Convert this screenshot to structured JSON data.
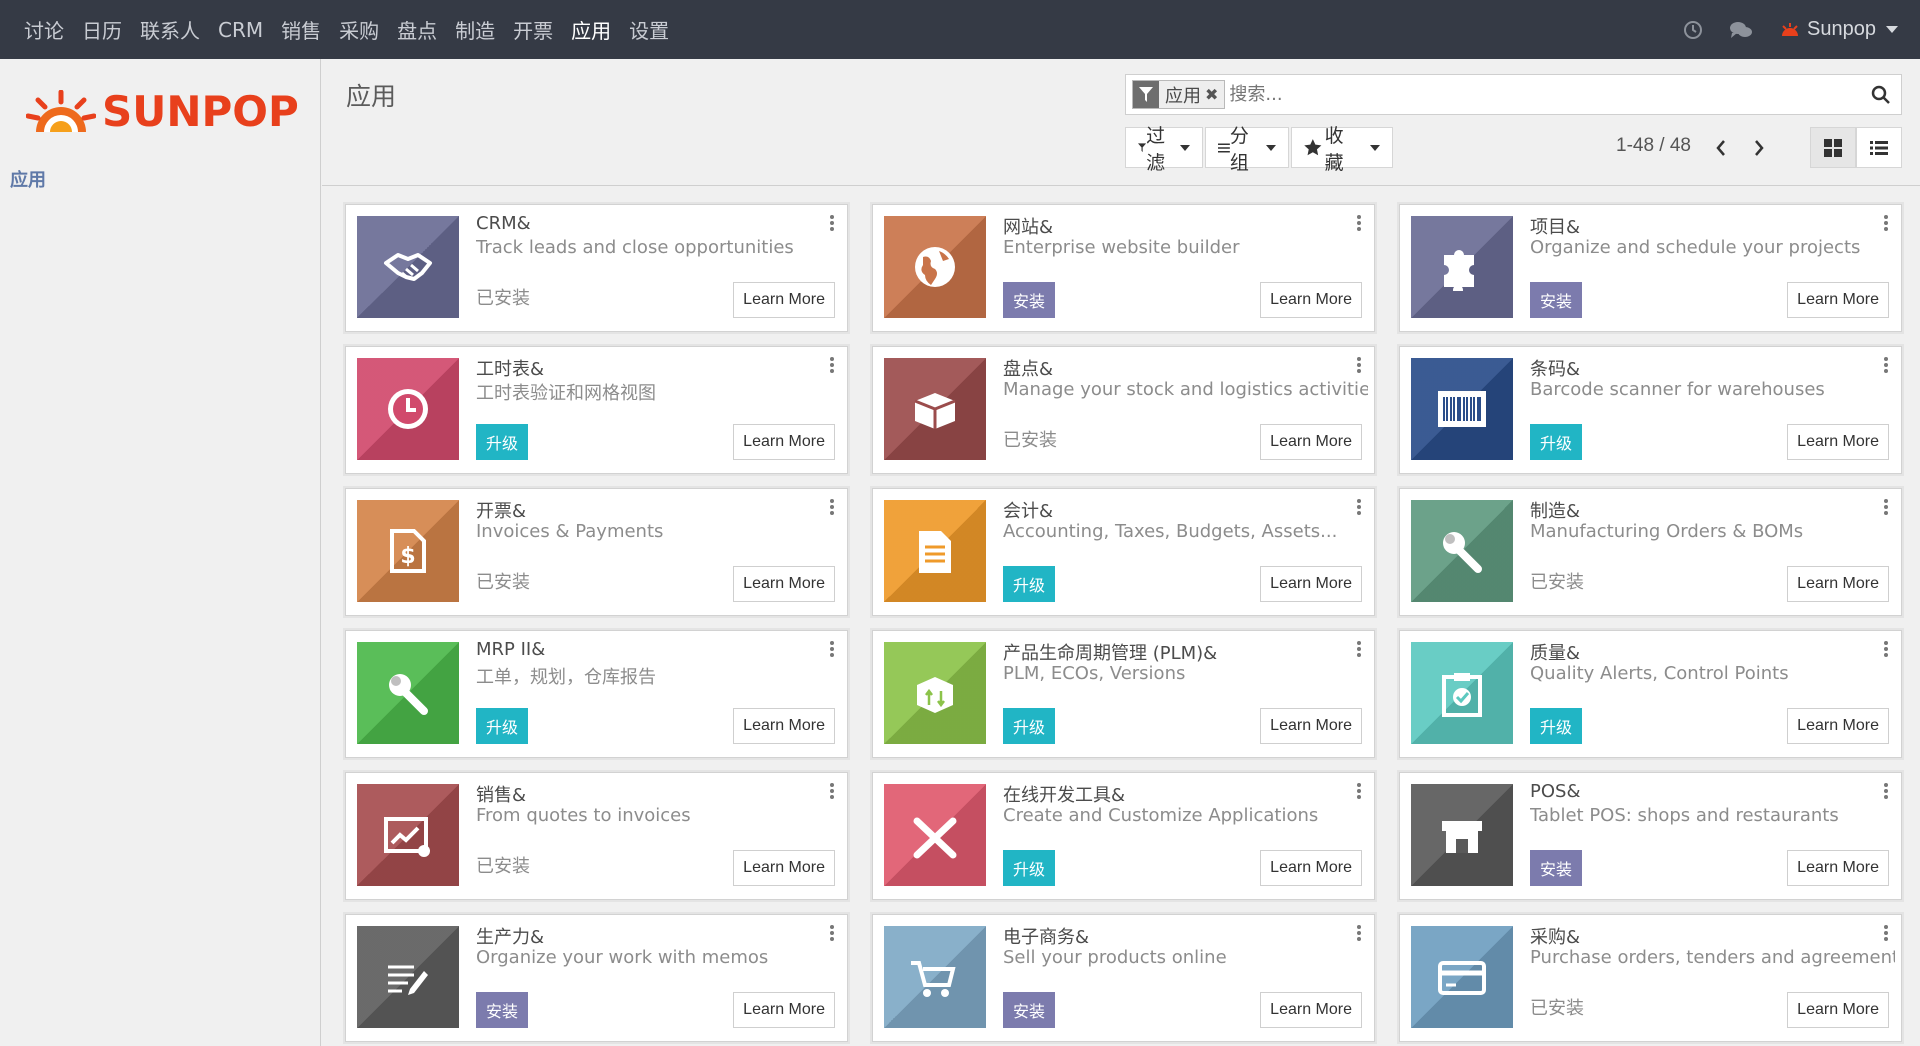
{
  "menu": [
    "讨论",
    "日历",
    "联系人",
    "CRM",
    "销售",
    "采购",
    "盘点",
    "制造",
    "开票",
    "应用",
    "设置"
  ],
  "active_menu": "应用",
  "user": {
    "name": "Sunpop"
  },
  "sidebar": {
    "logo_text": "SUNPOP",
    "link": "应用"
  },
  "control_panel": {
    "breadcrumb": "应用",
    "facet_label": "应用",
    "facet_remove": "✖",
    "search_placeholder": "搜索...",
    "filter_label": "过滤",
    "group_label": "分组",
    "favorite_label": "收藏",
    "pager": "1-48 / 48"
  },
  "colors": {
    "navbar": "#353a45",
    "install": "#7c7bad",
    "upgrade": "#21b5c5",
    "brand": "#e8401c"
  },
  "learn_more_label": "Learn More",
  "apps": [
    {
      "title": "CRM&",
      "summary": "Track leads and close opportunities",
      "state": "installed",
      "status_text": "已安装",
      "icon": "handshake-icon",
      "color": "#6a6c95"
    },
    {
      "title": "网站&",
      "summary": "Enterprise website builder",
      "state": "install",
      "status_text": "安装",
      "icon": "globe-icon",
      "color": "#c9744a"
    },
    {
      "title": "项目&",
      "summary": "Organize and schedule your projects",
      "state": "install",
      "status_text": "安装",
      "icon": "puzzle-icon",
      "color": "#6a6c95"
    },
    {
      "title": "工时表&",
      "summary": "工时表验证和网格视图",
      "state": "upgrade",
      "status_text": "升级",
      "icon": "clock-icon",
      "color": "#d14a6c"
    },
    {
      "title": "盘点&",
      "summary": "Manage your stock and logistics activities",
      "state": "installed",
      "status_text": "已安装",
      "icon": "box-icon",
      "color": "#9b4c4c"
    },
    {
      "title": "条码&",
      "summary": "Barcode scanner for warehouses",
      "state": "upgrade",
      "status_text": "升级",
      "icon": "barcode-icon",
      "color": "#2a4d8a"
    },
    {
      "title": "开票&",
      "summary": "Invoices & Payments",
      "state": "installed",
      "status_text": "已安装",
      "icon": "invoice-icon",
      "color": "#d4844a"
    },
    {
      "title": "会计&",
      "summary": "Accounting, Taxes, Budgets, Assets...",
      "state": "upgrade",
      "status_text": "升级",
      "icon": "document-icon",
      "color": "#ef9a2a"
    },
    {
      "title": "制造&",
      "summary": "Manufacturing Orders & BOMs",
      "state": "installed",
      "status_text": "已安装",
      "icon": "wrench-icon",
      "color": "#5f9a80"
    },
    {
      "title": "MRP II&",
      "summary": "工单，规划，仓库报告",
      "state": "upgrade",
      "status_text": "升级",
      "icon": "wrench-icon",
      "color": "#4cb94b"
    },
    {
      "title": "产品生命周期管理 (PLM)&",
      "summary": "PLM, ECOs, Versions",
      "state": "upgrade",
      "status_text": "升级",
      "icon": "cube-icon",
      "color": "#8cc34a"
    },
    {
      "title": "质量&",
      "summary": "Quality Alerts, Control Points",
      "state": "upgrade",
      "status_text": "升级",
      "icon": "clipboard-check-icon",
      "color": "#5cc9c0"
    },
    {
      "title": "销售&",
      "summary": "From quotes to invoices",
      "state": "installed",
      "status_text": "已安装",
      "icon": "chart-up-icon",
      "color": "#a64d4f"
    },
    {
      "title": "在线开发工具&",
      "summary": "Create and Customize Applications",
      "state": "upgrade",
      "status_text": "升级",
      "icon": "tools-icon",
      "color": "#e05a6e"
    },
    {
      "title": "POS&",
      "summary": "Tablet POS: shops and restaurants",
      "state": "install",
      "status_text": "安装",
      "icon": "shop-icon",
      "color": "#5a5a5a"
    },
    {
      "title": "生产力&",
      "summary": "Organize your work with memos",
      "state": "install",
      "status_text": "安装",
      "icon": "memo-icon",
      "color": "#5e5e5e"
    },
    {
      "title": "电子商务&",
      "summary": "Sell your products online",
      "state": "install",
      "status_text": "安装",
      "icon": "cart-icon",
      "color": "#7fa9c6"
    },
    {
      "title": "采购&",
      "summary": "Purchase orders, tenders and agreements",
      "state": "installed",
      "status_text": "已安装",
      "icon": "credit-card-icon",
      "color": "#6f9ec0"
    }
  ]
}
